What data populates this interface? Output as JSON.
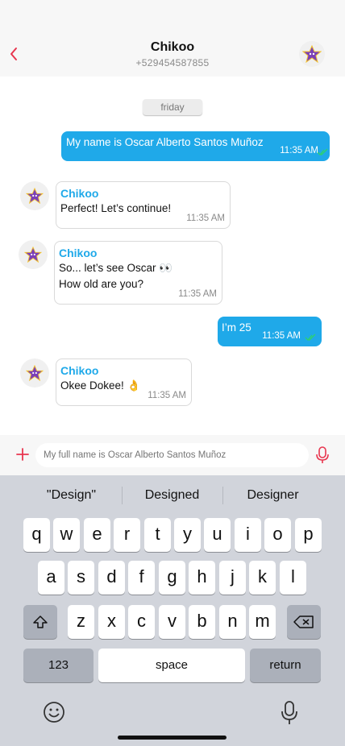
{
  "header": {
    "title": "Chikoo",
    "subtitle": "+529454587855"
  },
  "chat": {
    "date_label": "friday",
    "messages": [
      {
        "direction": "out",
        "text": "My name is Oscar Alberto Santos Muñoz",
        "time": "11:35 AM"
      },
      {
        "direction": "in",
        "sender": "Chikoo",
        "text": "Perfect! Let’s continue!",
        "time": "11:35 AM"
      },
      {
        "direction": "in",
        "sender": "Chikoo",
        "line1": "So... let’s see Oscar 👀",
        "line2": "How old are you?",
        "time": "11:35 AM"
      },
      {
        "direction": "out",
        "text": "I’m 25",
        "time": "11:35 AM"
      },
      {
        "direction": "in",
        "sender": "Chikoo",
        "text": "Okee Dokee! 👌",
        "time": "11:35 AM"
      }
    ]
  },
  "input": {
    "placeholder": "My full name is Oscar Alberto Santos Muñoz"
  },
  "keyboard": {
    "suggestions": [
      "\"Design\"",
      "Designed",
      "Designer"
    ],
    "row1": [
      "q",
      "w",
      "e",
      "r",
      "t",
      "y",
      "u",
      "i",
      "o",
      "p"
    ],
    "row2": [
      "a",
      "s",
      "d",
      "f",
      "g",
      "h",
      "j",
      "k",
      "l"
    ],
    "row3": [
      "z",
      "x",
      "c",
      "v",
      "b",
      "n",
      "m"
    ],
    "numbers_label": "123",
    "space_label": "space",
    "return_label": "return"
  },
  "colors": {
    "accent": "#1fa9e9",
    "back_arrow": "#e8364f",
    "read_check": "#2ed36b"
  },
  "icons": [
    "back-arrow-icon",
    "bot-star-icon",
    "double-check-icon",
    "plus-icon",
    "microphone-icon",
    "shift-icon",
    "backspace-icon",
    "emoji-icon",
    "dictation-icon"
  ]
}
